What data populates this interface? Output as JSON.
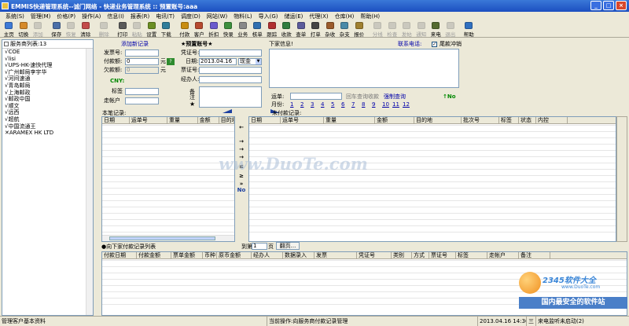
{
  "window": {
    "title": "EMMIS快递管理系统--诚门网络 - 快递业务管理系统 :: 预置账号:aaa",
    "min": "_",
    "max": "□",
    "close": "×"
  },
  "menu": [
    "系统(S)",
    "管理(M)",
    "价格(P)",
    "操作(A)",
    "信息(I)",
    "报表(R)",
    "电讯(T)",
    "调度(D)",
    "网站(W)",
    "物料(L)",
    "导入(G)",
    "储运(E)",
    "代理(X)",
    "仓库(H)",
    "帮助(H)"
  ],
  "toolbar": [
    {
      "label": "主页",
      "color": "#3d7ad6",
      "dis": false
    },
    {
      "label": "切换",
      "color": "#d68a2a",
      "dis": false
    },
    {
      "label": "添加",
      "color": "#999999",
      "dis": true
    },
    {
      "label": "保存",
      "color": "#4b6fa8",
      "dis": false
    },
    {
      "label": "恢复",
      "color": "#999999",
      "dis": true
    },
    {
      "label": "清除",
      "color": "#c34a4a",
      "dis": false
    },
    {
      "label": "删除",
      "color": "#999999",
      "dis": true
    },
    {
      "label": "打印",
      "color": "#5a5a5a",
      "dis": false
    },
    {
      "label": "粘贴",
      "color": "#999999",
      "dis": true
    },
    {
      "label": "设置",
      "color": "#6b8e23",
      "dis": false
    },
    {
      "label": "下载",
      "color": "#2f7d9a",
      "dis": false
    },
    {
      "label": "付款",
      "color": "#c88d10",
      "dis": false
    },
    {
      "label": "客户",
      "color": "#b6492f",
      "dis": false
    },
    {
      "label": "折扣",
      "color": "#6a5acd",
      "dis": false
    },
    {
      "label": "快录",
      "color": "#3d8f3d",
      "dis": false
    },
    {
      "label": "业务",
      "color": "#888888",
      "dis": false
    },
    {
      "label": "核单",
      "color": "#2f6fb0",
      "dis": false
    },
    {
      "label": "跟踪",
      "color": "#b03030",
      "dis": false
    },
    {
      "label": "收款",
      "color": "#2f7d3f",
      "dis": false
    },
    {
      "label": "查单",
      "color": "#5b5b9b",
      "dis": false
    },
    {
      "label": "打单",
      "color": "#444444",
      "dis": false
    },
    {
      "label": "杂收",
      "color": "#9b5b2b",
      "dis": false
    },
    {
      "label": "杂支",
      "color": "#4a8aa8",
      "dis": false
    },
    {
      "label": "报价",
      "color": "#a08030",
      "dis": false
    },
    {
      "label": "分线",
      "color": "#999999",
      "dis": true
    },
    {
      "label": "检查",
      "color": "#999999",
      "dis": true
    },
    {
      "label": "发帖",
      "color": "#999999",
      "dis": true
    },
    {
      "label": "通知",
      "color": "#999999",
      "dis": true
    },
    {
      "label": "来电",
      "color": "#556b2f",
      "dis": false
    },
    {
      "label": "退出",
      "color": "#999999",
      "dis": true
    },
    {
      "label": "帮助",
      "color": "#3070c0",
      "dis": false
    }
  ],
  "left_panel": {
    "header": "服务商列表:13",
    "items": [
      "COE",
      "lisi",
      "UPS-HK-速快代理",
      "广州邮局李宇华",
      "河间速通",
      "青岛邮局",
      "上海邮政",
      "邮政中国",
      "顺文",
      "远西",
      "超航",
      "中国流通王",
      "ARAMEX HK LTD"
    ]
  },
  "form": {
    "add_record": "添加新记录",
    "preset_account": "★预置账号★",
    "fapiao_label": "发票号:",
    "fapiao_value": "",
    "voucher_label": "凭证号:",
    "voucher_value": "",
    "paid_label": "付款额:",
    "paid_value": "0",
    "yuan": "元",
    "go": "?",
    "date_label": "日期:",
    "date_value": "2013.04.16",
    "currency": "现金",
    "owed_label": "欠款额:",
    "owed_value": "0",
    "yuan2": "元",
    "receipt_label": "票证号:",
    "receipt_value": "",
    "cny": "CNY:",
    "handler_label": "经办人:",
    "handler_value": "",
    "tag_label": "标签",
    "notes_label": "备注",
    "star": "★",
    "walk_label": "走帐户",
    "next_info": "下家信息!",
    "contact": "联系电话:",
    "tail_label": "尾款冲销",
    "tail_checked": "✓",
    "waybill_label": "运单:",
    "recheck": "回车查询收款",
    "force_query": "强制查询",
    "no_label": "↑No",
    "month_label": "月份:",
    "months": [
      "1",
      "2",
      "3",
      "4",
      "5",
      "6",
      "7",
      "8",
      "9",
      "10",
      "11",
      "12"
    ]
  },
  "left_table": {
    "title": "本笔记录:",
    "columns": [
      "日期",
      "运单号",
      "重量",
      "金额",
      "目的地"
    ]
  },
  "right_table": {
    "title": "未付款记录:",
    "columns": [
      "日期",
      "运单号",
      "重量",
      "金额",
      "目的地",
      "批次号",
      "标签",
      "状态",
      "内控"
    ]
  },
  "midbar": {
    "arrows": [
      "←",
      "→",
      "→",
      "→",
      "≤",
      "≥",
      "»",
      "No"
    ]
  },
  "bottom": {
    "title": "●向下家付款记录列表",
    "page_label": "到第",
    "page_value": "1",
    "page_unit": "页",
    "page_btn": "翻页...",
    "columns": [
      "付款日期",
      "付款金额",
      "票单金额",
      "币种",
      "原币金额",
      "经办人",
      "数据录入",
      "发票",
      "凭证号",
      "类别",
      "方式",
      "票证号",
      "标签",
      "走帐户",
      "备注"
    ]
  },
  "status": {
    "left": "管理客户基本资料",
    "middle": "当前操作:向服务商付款记录管理",
    "time": "2013.04.16 14:36:42",
    "conn": "三",
    "phone": "来电监听未启动(2)"
  },
  "watermark": {
    "center": "www.DuoTe.com",
    "brand": "2345软件大全",
    "brand_url": "www.DuoTe.com",
    "brand_slogan": "国内最安全的软件站"
  }
}
